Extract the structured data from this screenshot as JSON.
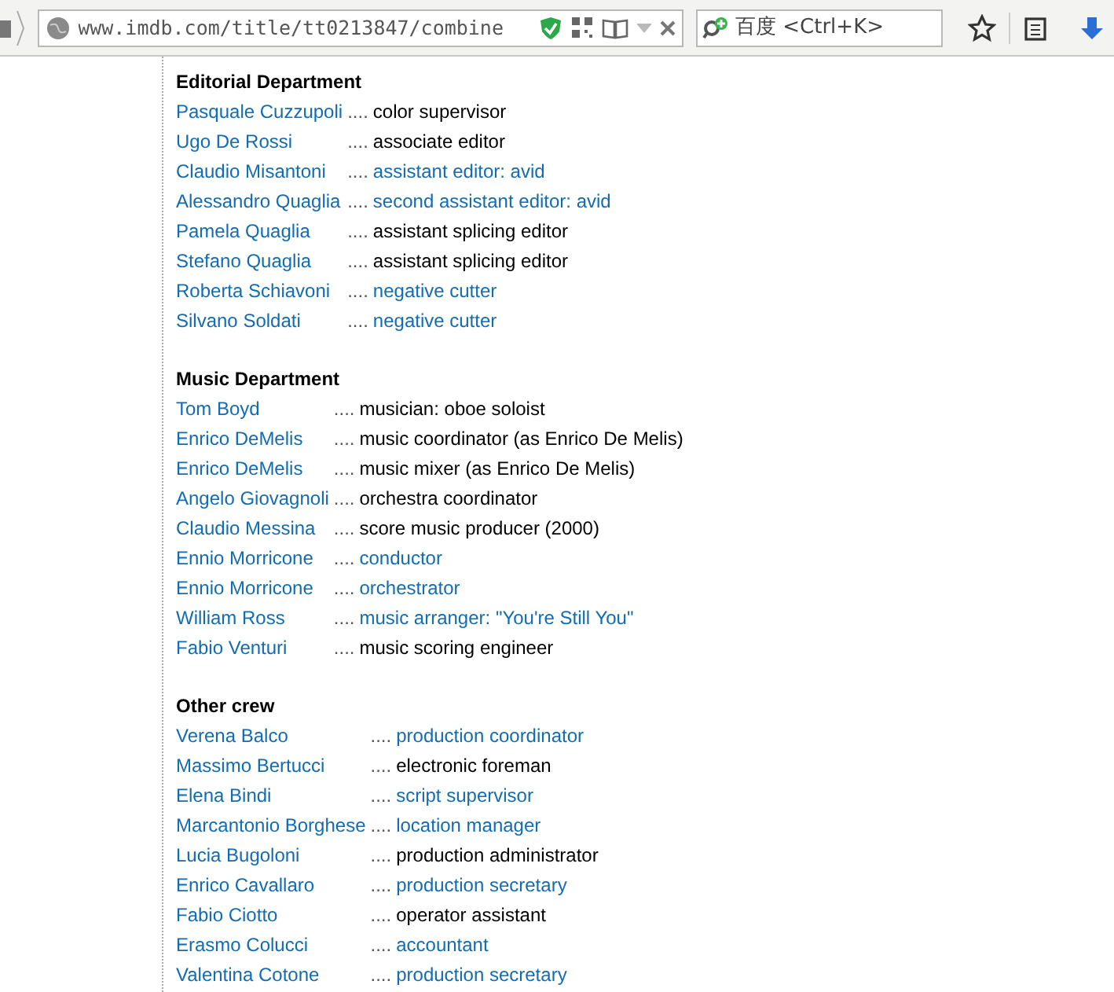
{
  "toolbar": {
    "url": "www.imdb.com/title/tt0213847/combine",
    "search": {
      "placeholder": "百度 <Ctrl+K>"
    }
  },
  "sections": [
    {
      "title": "Editorial Department",
      "credits": [
        {
          "name": "Pasquale Cuzzupoli",
          "dots": "....",
          "role": "color supervisor",
          "linked": false
        },
        {
          "name": "Ugo De Rossi",
          "dots": "....",
          "role": "associate editor",
          "linked": false
        },
        {
          "name": "Claudio Misantoni",
          "dots": "....",
          "role": "assistant editor: avid",
          "linked": true
        },
        {
          "name": "Alessandro Quaglia",
          "dots": "....",
          "role": "second assistant editor: avid",
          "linked": true
        },
        {
          "name": "Pamela Quaglia",
          "dots": "....",
          "role": "assistant splicing editor",
          "linked": false
        },
        {
          "name": "Stefano Quaglia",
          "dots": "....",
          "role": "assistant splicing editor",
          "linked": false
        },
        {
          "name": "Roberta Schiavoni",
          "dots": "....",
          "role": "negative cutter",
          "linked": true
        },
        {
          "name": "Silvano Soldati",
          "dots": "....",
          "role": "negative cutter",
          "linked": true
        }
      ]
    },
    {
      "title": "Music Department",
      "credits": [
        {
          "name": "Tom Boyd",
          "dots": "....",
          "role": "musician: oboe soloist",
          "linked": false
        },
        {
          "name": "Enrico DeMelis",
          "dots": "....",
          "role": "music coordinator (as Enrico De Melis)",
          "linked": false
        },
        {
          "name": "Enrico DeMelis",
          "dots": "....",
          "role": "music mixer (as Enrico De Melis)",
          "linked": false
        },
        {
          "name": "Angelo Giovagnoli",
          "dots": "....",
          "role": "orchestra coordinator",
          "linked": false
        },
        {
          "name": "Claudio Messina",
          "dots": "....",
          "role": "score music producer (2000)",
          "linked": false
        },
        {
          "name": "Ennio Morricone",
          "dots": "....",
          "role": "conductor",
          "linked": true
        },
        {
          "name": "Ennio Morricone",
          "dots": "....",
          "role": "orchestrator",
          "linked": true
        },
        {
          "name": "William Ross",
          "dots": "....",
          "role": "music arranger: \"You're Still You\"",
          "linked": true
        },
        {
          "name": "Fabio Venturi",
          "dots": "....",
          "role": "music scoring engineer",
          "linked": false
        }
      ]
    },
    {
      "title": "Other crew",
      "credits": [
        {
          "name": "Verena Balco",
          "dots": "....",
          "role": "production coordinator",
          "linked": true
        },
        {
          "name": "Massimo Bertucci",
          "dots": "....",
          "role": "electronic foreman",
          "linked": false
        },
        {
          "name": "Elena Bindi",
          "dots": "....",
          "role": "script supervisor",
          "linked": true
        },
        {
          "name": "Marcantonio Borghese",
          "dots": "....",
          "role": "location manager",
          "linked": true
        },
        {
          "name": "Lucia Bugoloni",
          "dots": "....",
          "role": "production administrator",
          "linked": false
        },
        {
          "name": "Enrico Cavallaro",
          "dots": "....",
          "role": "production secretary",
          "linked": true
        },
        {
          "name": "Fabio Ciotto",
          "dots": "....",
          "role": "operator assistant",
          "linked": false
        },
        {
          "name": "Erasmo Colucci",
          "dots": "....",
          "role": "accountant",
          "linked": true
        },
        {
          "name": "Valentina Cotone",
          "dots": "....",
          "role": "production secretary",
          "linked": true
        }
      ]
    }
  ]
}
